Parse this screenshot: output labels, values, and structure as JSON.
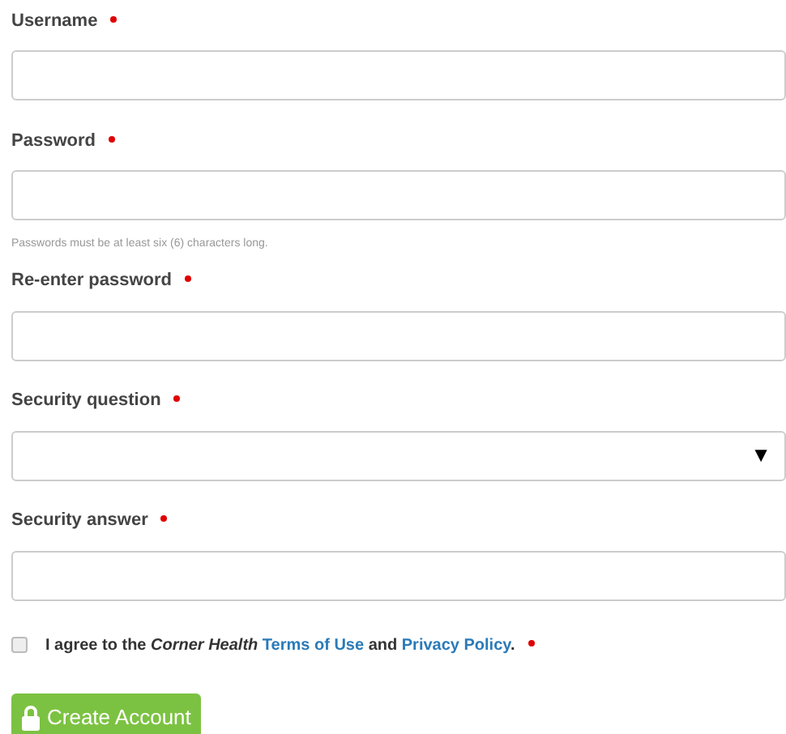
{
  "fields": [
    {
      "label": "Username",
      "kind": "text",
      "required": true
    },
    {
      "label": "Password",
      "kind": "text",
      "required": true,
      "hint": "Passwords must be at least six (6) characters long."
    },
    {
      "label": "Re-enter password",
      "kind": "text",
      "required": true
    },
    {
      "label": "Security question",
      "kind": "select",
      "required": true,
      "arrow": "▼"
    },
    {
      "label": "Security answer",
      "kind": "text",
      "required": true
    }
  ],
  "agreement": {
    "checked": false,
    "required": true,
    "before": "I agree to the *Corner Health*",
    "terms_link": "Terms of Use",
    "middle": "and",
    "privacy_link": "Privacy Policy",
    "after": "."
  },
  "submit": {
    "label": "Create Account"
  }
}
